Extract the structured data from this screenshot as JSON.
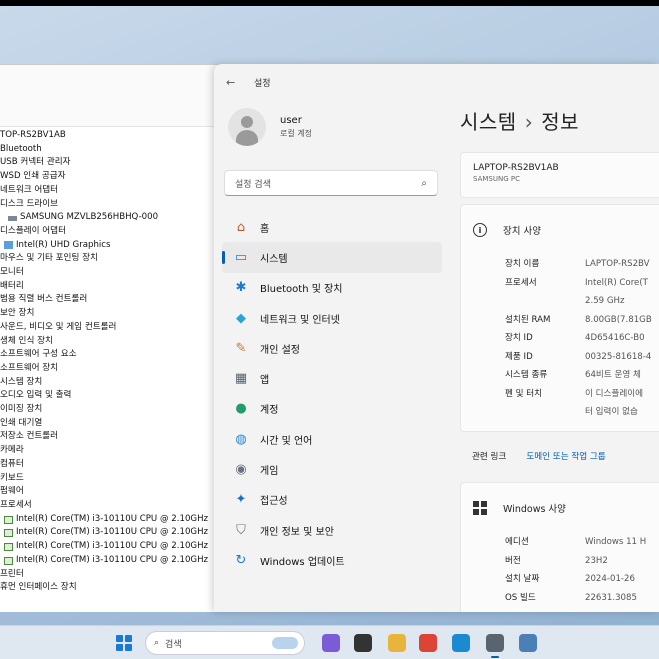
{
  "device_manager": {
    "items": [
      {
        "label": "TOP-RS2BV1AB",
        "indent": 0,
        "icon": "computer-icon"
      },
      {
        "label": "Bluetooth",
        "indent": 0,
        "icon": "bluetooth-icon"
      },
      {
        "label": "USB 커넥터 관리자",
        "indent": 0,
        "icon": "usb-icon"
      },
      {
        "label": "WSD 인쇄 공급자",
        "indent": 0,
        "icon": "printer-icon"
      },
      {
        "label": "네트워크 어댑터",
        "indent": 0,
        "icon": "network-icon"
      },
      {
        "label": "디스크 드라이브",
        "indent": 0,
        "icon": "disk-icon"
      },
      {
        "label": "SAMSUNG MZVLB256HBHQ-000",
        "indent": 2,
        "icon": "disk-icon"
      },
      {
        "label": "디스플레이 어댑터",
        "indent": 0,
        "icon": "display-icon"
      },
      {
        "label": "Intel(R) UHD Graphics",
        "indent": 1,
        "icon": "gpu-icon"
      },
      {
        "label": "마우스 및 기타 포인팅 장치",
        "indent": 0,
        "icon": "mouse-icon"
      },
      {
        "label": "모니터",
        "indent": 0,
        "icon": "monitor-icon"
      },
      {
        "label": "배터리",
        "indent": 0,
        "icon": "battery-icon"
      },
      {
        "label": "범용 직렬 버스 컨트롤러",
        "indent": 0,
        "icon": "usb-icon"
      },
      {
        "label": "보안 장치",
        "indent": 0,
        "icon": "security-icon"
      },
      {
        "label": "사운드, 비디오 및 게임 컨트롤러",
        "indent": 0,
        "icon": "sound-icon"
      },
      {
        "label": "생체 인식 장치",
        "indent": 0,
        "icon": "biometric-icon"
      },
      {
        "label": "소프트웨어 구성 요소",
        "indent": 0,
        "icon": "software-icon"
      },
      {
        "label": "소프트웨어 장치",
        "indent": 0,
        "icon": "software-icon"
      },
      {
        "label": "시스템 장치",
        "indent": 0,
        "icon": "system-icon"
      },
      {
        "label": "오디오 입력 및 출력",
        "indent": 0,
        "icon": "audio-icon"
      },
      {
        "label": "이미징 장치",
        "indent": 0,
        "icon": "camera-icon"
      },
      {
        "label": "인쇄 대기열",
        "indent": 0,
        "icon": "printer-icon"
      },
      {
        "label": "저장소 컨트롤러",
        "indent": 0,
        "icon": "storage-icon"
      },
      {
        "label": "카메라",
        "indent": 0,
        "icon": "camera-icon"
      },
      {
        "label": "컴퓨터",
        "indent": 0,
        "icon": "computer-icon"
      },
      {
        "label": "키보드",
        "indent": 0,
        "icon": "keyboard-icon"
      },
      {
        "label": "펌웨어",
        "indent": 0,
        "icon": "firmware-icon"
      },
      {
        "label": "프로세서",
        "indent": 0,
        "icon": "processor-icon"
      },
      {
        "label": "Intel(R) Core(TM) i3-10110U CPU @ 2.10GHz",
        "indent": 1,
        "icon": "cpu-icon"
      },
      {
        "label": "Intel(R) Core(TM) i3-10110U CPU @ 2.10GHz",
        "indent": 1,
        "icon": "cpu-icon"
      },
      {
        "label": "Intel(R) Core(TM) i3-10110U CPU @ 2.10GHz",
        "indent": 1,
        "icon": "cpu-icon"
      },
      {
        "label": "Intel(R) Core(TM) i3-10110U CPU @ 2.10GHz",
        "indent": 1,
        "icon": "cpu-icon"
      },
      {
        "label": "프린터",
        "indent": 0,
        "icon": "printer-icon"
      },
      {
        "label": "휴먼 인터페이스 장치",
        "indent": 0,
        "icon": "hid-icon"
      }
    ]
  },
  "settings": {
    "title": "설정",
    "back_icon": "back-arrow-icon",
    "user": {
      "name": "user",
      "type": "로컬 계정"
    },
    "search": {
      "placeholder": "설정 검색"
    },
    "nav": [
      {
        "label": "홈",
        "icon": "home-icon",
        "color": "#c15a2c",
        "glyph": "⌂"
      },
      {
        "label": "시스템",
        "icon": "system-icon",
        "color": "#2b7cd3",
        "glyph": "▭",
        "active": true
      },
      {
        "label": "Bluetooth 및 장치",
        "icon": "bluetooth-icon",
        "color": "#1f7ad3",
        "glyph": "✱"
      },
      {
        "label": "네트워크 및 인터넷",
        "icon": "wifi-icon",
        "color": "#2aa3d8",
        "glyph": "◆"
      },
      {
        "label": "개인 설정",
        "icon": "brush-icon",
        "color": "#c47a2a",
        "glyph": "✎"
      },
      {
        "label": "앱",
        "icon": "apps-icon",
        "color": "#55606e",
        "glyph": "▦"
      },
      {
        "label": "계정",
        "icon": "account-icon",
        "color": "#1f9d6b",
        "glyph": "●"
      },
      {
        "label": "시간 및 언어",
        "icon": "globe-icon",
        "color": "#2a86d1",
        "glyph": "◍"
      },
      {
        "label": "게임",
        "icon": "gamepad-icon",
        "color": "#6b7380",
        "glyph": "◉"
      },
      {
        "label": "접근성",
        "icon": "accessibility-icon",
        "color": "#1a6fc2",
        "glyph": "✦"
      },
      {
        "label": "개인 정보 및 보안",
        "icon": "shield-icon",
        "color": "#6a7382",
        "glyph": "⛉"
      },
      {
        "label": "Windows 업데이트",
        "icon": "update-icon",
        "color": "#1b79d0",
        "glyph": "↻"
      }
    ],
    "page": {
      "title": "시스템",
      "subtitle": "정보",
      "separator": "›"
    },
    "device_card": {
      "name": "LAPTOP-RS2BV1AB",
      "model": "SAMSUNG PC"
    },
    "spec_card": {
      "header": "장치 사양",
      "rows": [
        {
          "k": "장치 이름",
          "v": "LAPTOP-RS2BV"
        },
        {
          "k": "프로세서",
          "v": "Intel(R) Core(T"
        },
        {
          "k": "",
          "v": "2.59 GHz"
        },
        {
          "k": "설치된 RAM",
          "v": "8.00GB(7.81GB"
        },
        {
          "k": "장치 ID",
          "v": "4D65416C-B0"
        },
        {
          "k": "제품 ID",
          "v": "00325-81618-4"
        },
        {
          "k": "시스템 종류",
          "v": "64비트 운영 체"
        },
        {
          "k": "펜 및 터치",
          "v": "이 디스플레이에"
        },
        {
          "k": "",
          "v": "터 입력이 없습"
        }
      ]
    },
    "links": {
      "label": "관련 링크",
      "link": "도메인 또는 작업 그룹"
    },
    "win_card": {
      "header": "Windows 사양",
      "rows": [
        {
          "k": "에디션",
          "v": "Windows 11 H"
        },
        {
          "k": "버전",
          "v": "23H2"
        },
        {
          "k": "설치 날짜",
          "v": "2024-01-26"
        },
        {
          "k": "OS 빌드",
          "v": "22631.3085"
        }
      ]
    }
  },
  "taskbar": {
    "search_placeholder": "검색",
    "icons": [
      {
        "name": "copilot-icon",
        "color": "#7b5bd6"
      },
      {
        "name": "task-view-icon",
        "color": "#333"
      },
      {
        "name": "file-explorer-icon",
        "color": "#e8b53a"
      },
      {
        "name": "chrome-icon",
        "color": "#db4437"
      },
      {
        "name": "edge-icon",
        "color": "#1b8ad0"
      },
      {
        "name": "settings-gear-icon",
        "color": "#5a6470",
        "active": true
      },
      {
        "name": "device-manager-icon",
        "color": "#4a7fb8"
      }
    ]
  }
}
